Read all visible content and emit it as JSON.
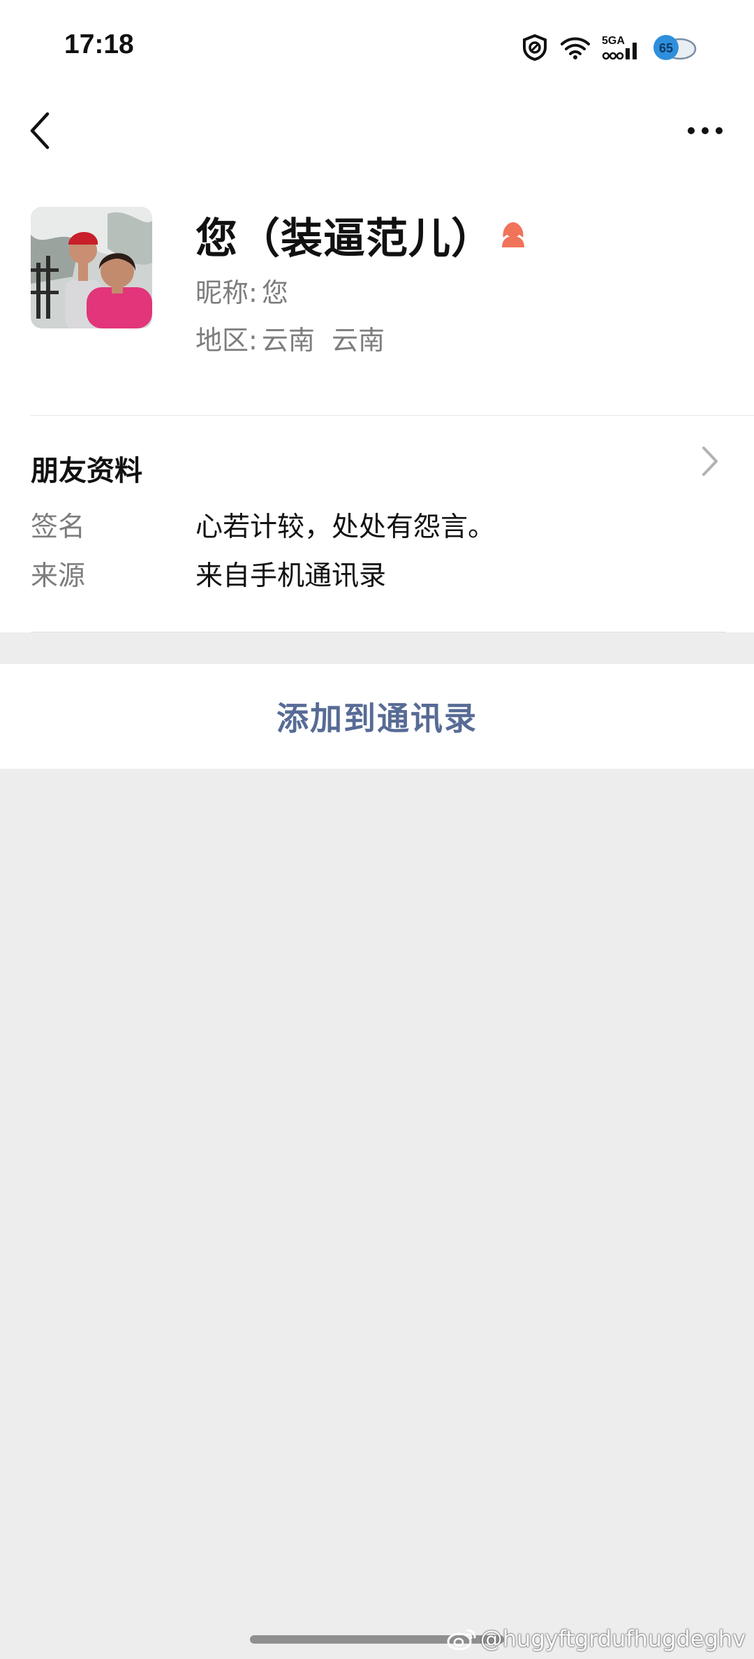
{
  "status_bar": {
    "time": "17:18",
    "network_label": "5GA",
    "battery_level": "65"
  },
  "nav": {
    "back_icon": "chevron-left-icon",
    "more_icon": "more-horizontal-icon"
  },
  "profile": {
    "name": "您（装逼范儿）",
    "gender_icon": "female-icon",
    "gender_color": "#f0735a",
    "nickname_label": "昵称:",
    "nickname_value": "您",
    "region_label": "地区:",
    "region_value": "云南  云南"
  },
  "friend_info": {
    "title": "朋友资料",
    "signature_label": "签名",
    "signature_value": "心若计较，处处有怨言。",
    "source_label": "来源",
    "source_value": "来自手机通讯录"
  },
  "actions": {
    "add_to_contacts": "添加到通讯录",
    "accent_color": "#576b95"
  },
  "watermark": {
    "text": "@hugyftgrdufhugdeghv"
  }
}
